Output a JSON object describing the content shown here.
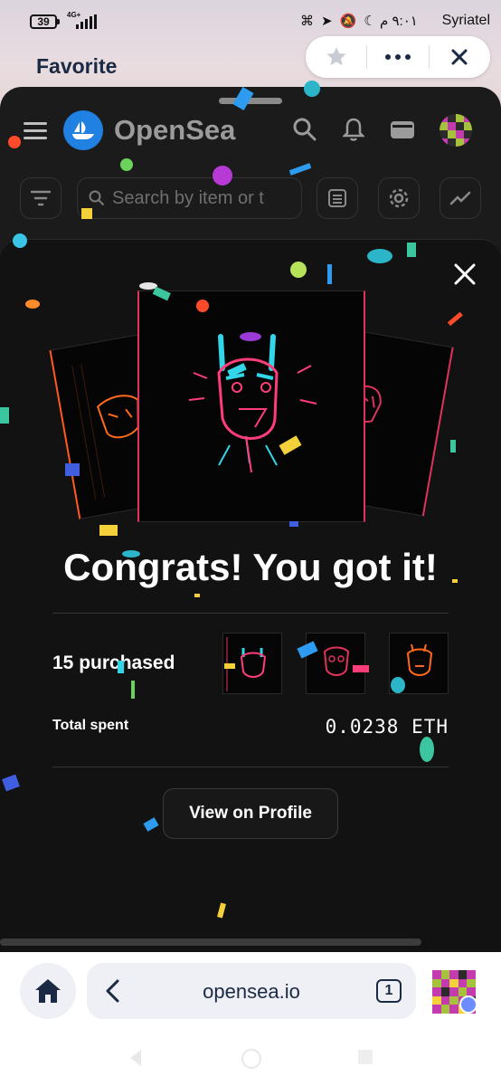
{
  "status_bar": {
    "battery": "39",
    "network": "4G+",
    "time": "٩:٠١ م",
    "carrier": "Syriatel"
  },
  "browser_header": {
    "title": "Favorite"
  },
  "opensea_header": {
    "brand": "OpenSea",
    "search_placeholder": "Search by item or t"
  },
  "modal": {
    "headline": "Congrats! You got it!",
    "purchased_label": "15 purchased",
    "total_label": "Total spent",
    "total_value": "0.0238 ETH",
    "cta_label": "View on Profile"
  },
  "browser_bar": {
    "url": "opensea.io",
    "tab_count": "1"
  },
  "colors": {
    "opensea_blue": "#2081e2",
    "sheet_bg": "#1b1b1b",
    "modal_bg": "#121212",
    "accent_pink": "#e0335b"
  },
  "icons": [
    "star-icon",
    "more-icon",
    "close-icon",
    "menu-icon",
    "search-icon",
    "bell-icon",
    "wallet-icon",
    "filter-icon",
    "list-view-icon",
    "settings-icon",
    "activity-icon",
    "home-icon",
    "back-icon"
  ]
}
